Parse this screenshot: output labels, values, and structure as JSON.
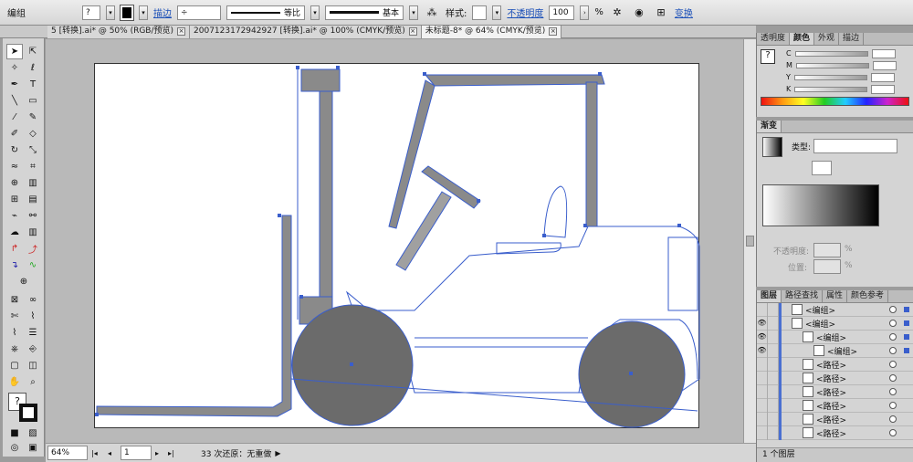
{
  "control_bar": {
    "group_label": "编组",
    "stroke_label": "描边",
    "stroke_profile_1": "等比",
    "stroke_profile_2": "基本",
    "style_label": "样式:",
    "opacity_label": "不透明度",
    "opacity_value": "100",
    "opacity_unit": "%",
    "transform_label": "变换"
  },
  "doc_tabs": [
    {
      "label": "5 [转换].ai* @ 50% (RGB/预览)"
    },
    {
      "label": "2007123172942927 [转换].ai* @ 100% (CMYK/预览)"
    },
    {
      "label": "未标题-8* @ 64% (CMYK/预览)"
    }
  ],
  "status_bar": {
    "zoom": "64%",
    "page": "1",
    "history": "33 次还原：无重做"
  },
  "color_panel": {
    "tabs": [
      "透明度",
      "颜色",
      "外观",
      "描边"
    ],
    "channels": [
      "C",
      "M",
      "Y",
      "K"
    ]
  },
  "gradient_panel": {
    "tab": "渐变",
    "type_label": "类型:",
    "opacity_label": "不透明度:",
    "opacity_unit": "%",
    "location_label": "位置:",
    "location_unit": "%"
  },
  "layers_panel": {
    "tabs": [
      "图层",
      "路径查找",
      "属性",
      "颜色参考"
    ],
    "rows": [
      "<编组>",
      "<编组>",
      "<编组>",
      "<编组>",
      "<路径>",
      "<路径>",
      "<路径>",
      "<路径>",
      "<路径>",
      "<路径>"
    ],
    "footer": "1 个图层"
  },
  "colors": {
    "forklift_fill": "#8a8a8a",
    "wheel_fill": "#6b6b6b",
    "selection": "#3a5ecc"
  }
}
